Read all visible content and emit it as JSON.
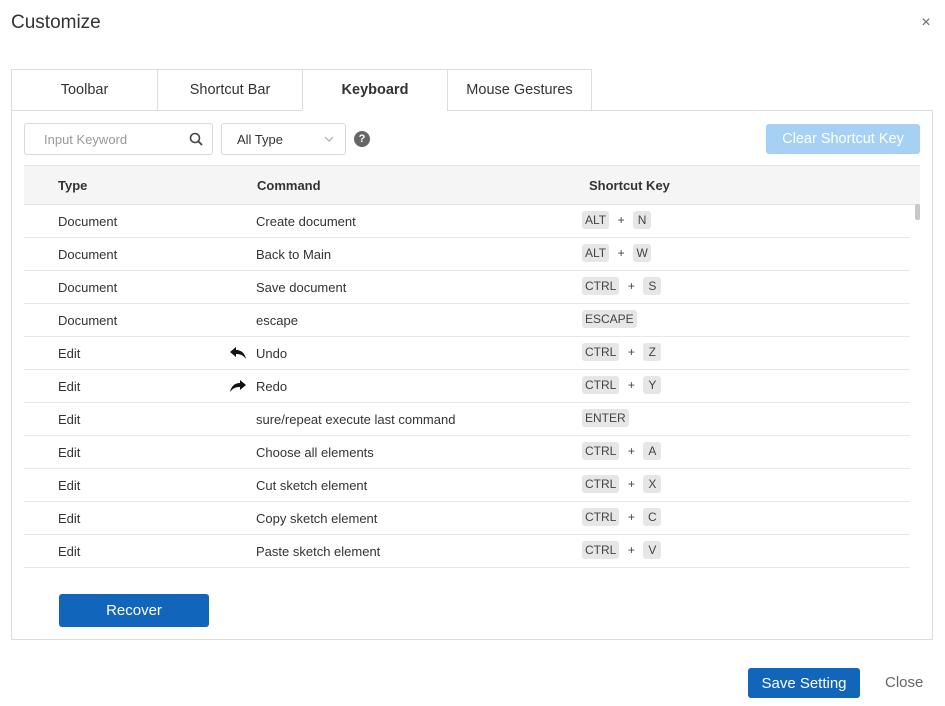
{
  "dialog": {
    "title": "Customize",
    "close_glyph": "×"
  },
  "tabs": [
    {
      "label": "Toolbar",
      "active": false
    },
    {
      "label": "Shortcut Bar",
      "active": false
    },
    {
      "label": "Keyboard",
      "active": true
    },
    {
      "label": "Mouse Gestures",
      "active": false
    }
  ],
  "filters": {
    "search_placeholder": "Input Keyword",
    "type_selected": "All Type",
    "help_glyph": "?"
  },
  "clear_button": "Clear Shortcut Key",
  "table": {
    "headers": {
      "type": "Type",
      "command": "Command",
      "shortcut": "Shortcut Key"
    },
    "rows": [
      {
        "type": "Document",
        "command": "Create document",
        "keys": [
          "ALT",
          "N"
        ]
      },
      {
        "type": "Document",
        "command": "Back to Main",
        "keys": [
          "ALT",
          "W"
        ]
      },
      {
        "type": "Document",
        "command": "Save document",
        "keys": [
          "CTRL",
          "S"
        ]
      },
      {
        "type": "Document",
        "command": "escape",
        "keys": [
          "ESCAPE"
        ]
      },
      {
        "type": "Edit",
        "command": "Undo",
        "icon": "undo-arrow-icon",
        "keys": [
          "CTRL",
          "Z"
        ]
      },
      {
        "type": "Edit",
        "command": "Redo",
        "icon": "redo-arrow-icon",
        "keys": [
          "CTRL",
          "Y"
        ]
      },
      {
        "type": "Edit",
        "command": "sure/repeat execute last command",
        "keys": [
          "ENTER"
        ]
      },
      {
        "type": "Edit",
        "command": "Choose all elements",
        "keys": [
          "CTRL",
          "A"
        ]
      },
      {
        "type": "Edit",
        "command": "Cut sketch element",
        "keys": [
          "CTRL",
          "X"
        ]
      },
      {
        "type": "Edit",
        "command": "Copy sketch element",
        "keys": [
          "CTRL",
          "C"
        ]
      },
      {
        "type": "Edit",
        "command": "Paste sketch element",
        "keys": [
          "CTRL",
          "V"
        ]
      }
    ],
    "key_separator": "+"
  },
  "footer": {
    "recover": "Recover",
    "save": "Save Setting",
    "close": "Close"
  },
  "colors": {
    "primary": "#1166bb",
    "disabled_primary": "#a6d1f5",
    "border": "#dcdcdc",
    "key_bg": "#e6e6e6"
  }
}
